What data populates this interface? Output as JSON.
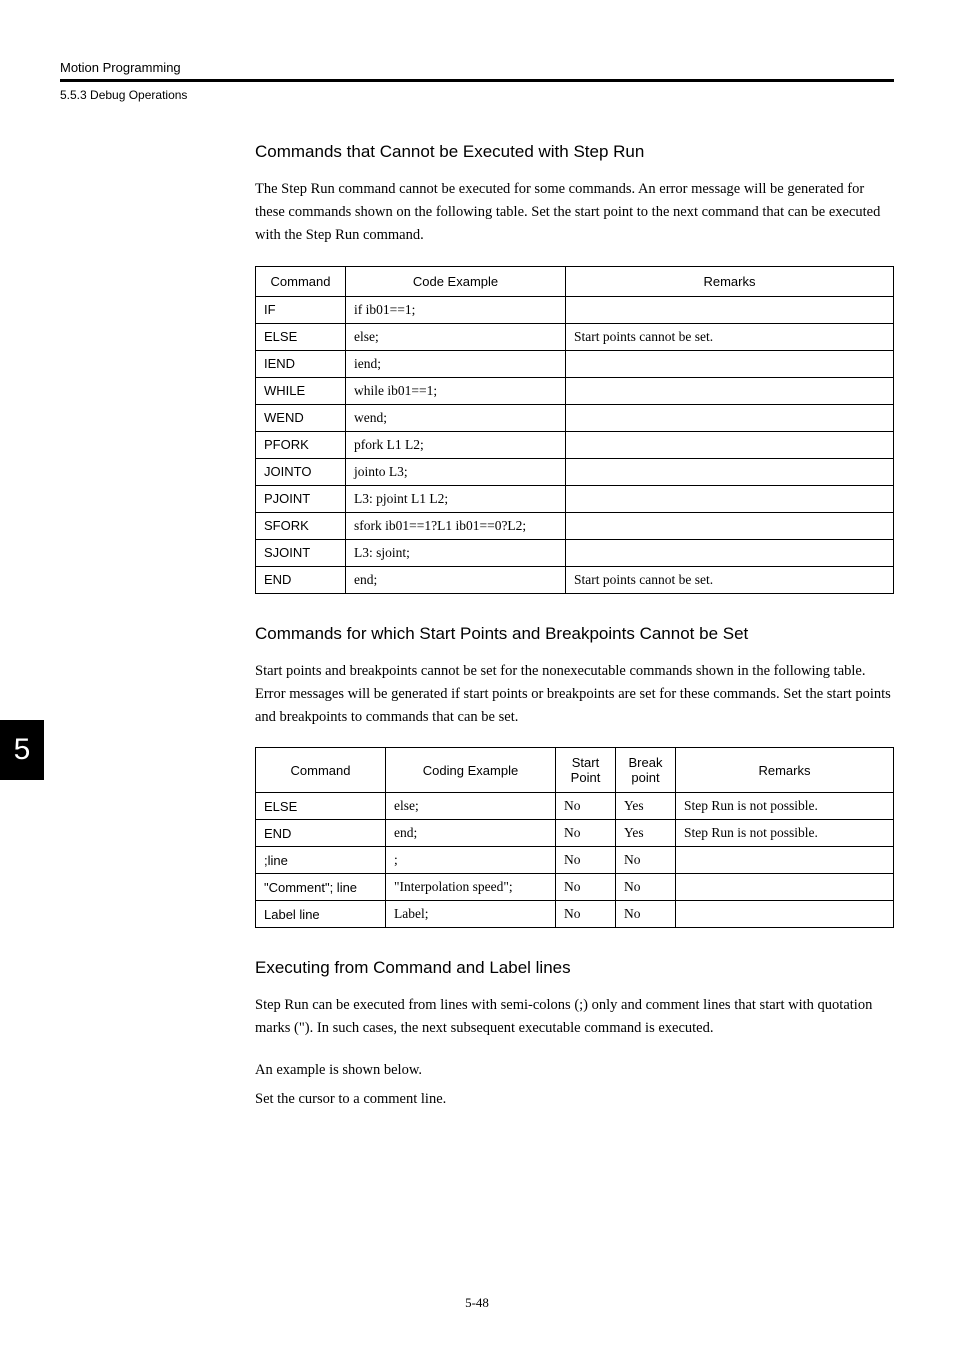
{
  "header": {
    "chapter": "Motion Programming",
    "section": "5.5.3  Debug Operations"
  },
  "sideTab": "5",
  "pageNumber": "5-48",
  "sections": [
    {
      "heading": "Commands that Cannot be Executed with Step Run",
      "paragraphs": [
        "The Step Run command cannot be executed for some commands. An error message will be generated for these commands shown on the following table. Set the start point to the next command that can be executed with the Step Run command."
      ]
    },
    {
      "heading": "Commands for which Start Points and Breakpoints Cannot be Set",
      "paragraphs": [
        "Start points and breakpoints cannot be set for the nonexecutable commands shown in the following table. Error messages will be generated if start points or breakpoints are set for these commands. Set the start points and breakpoints to commands that can be set."
      ]
    },
    {
      "heading": "Executing from Command and Label lines",
      "paragraphs": [
        "Step Run can be executed from lines with semi-colons (;) only and comment lines that start with quotation marks (\"). In such cases, the next subsequent executable command is executed.",
        "An example is shown below.",
        "Set the cursor to a comment line."
      ]
    }
  ],
  "table1": {
    "headers": [
      "Command",
      "Code Example",
      "Remarks"
    ],
    "rows": [
      {
        "cmd": "IF",
        "code": "if ib01==1;",
        "remark": ""
      },
      {
        "cmd": "ELSE",
        "code": "else;",
        "remark": "Start points cannot be set."
      },
      {
        "cmd": "IEND",
        "code": "iend;",
        "remark": ""
      },
      {
        "cmd": "WHILE",
        "code": "while ib01==1;",
        "remark": ""
      },
      {
        "cmd": "WEND",
        "code": "wend;",
        "remark": ""
      },
      {
        "cmd": "PFORK",
        "code": "pfork L1 L2;",
        "remark": ""
      },
      {
        "cmd": "JOINTO",
        "code": "jointo L3;",
        "remark": ""
      },
      {
        "cmd": "PJOINT",
        "code": "L3: pjoint L1 L2;",
        "remark": ""
      },
      {
        "cmd": "SFORK",
        "code": "sfork ib01==1?L1 ib01==0?L2;",
        "remark": ""
      },
      {
        "cmd": "SJOINT",
        "code": "L3: sjoint;",
        "remark": ""
      },
      {
        "cmd": "END",
        "code": "end;",
        "remark": "Start points cannot be set."
      }
    ]
  },
  "table2": {
    "headers": [
      "Command",
      "Coding Example",
      "Start Point",
      "Break point",
      "Remarks"
    ],
    "rows": [
      {
        "cmd": "ELSE",
        "code": "else;",
        "sp": "No",
        "bp": "Yes",
        "remark": "Step Run is not possible."
      },
      {
        "cmd": "END",
        "code": "end;",
        "sp": "No",
        "bp": "Yes",
        "remark": "Step Run is not possible."
      },
      {
        "cmd": ";line",
        "code": ";",
        "sp": "No",
        "bp": "No",
        "remark": ""
      },
      {
        "cmd": "\"Comment\"; line",
        "code": "\"Interpolation speed\";",
        "sp": "No",
        "bp": "No",
        "remark": ""
      },
      {
        "cmd": "Label line",
        "code": "Label;",
        "sp": "No",
        "bp": "No",
        "remark": ""
      }
    ]
  }
}
